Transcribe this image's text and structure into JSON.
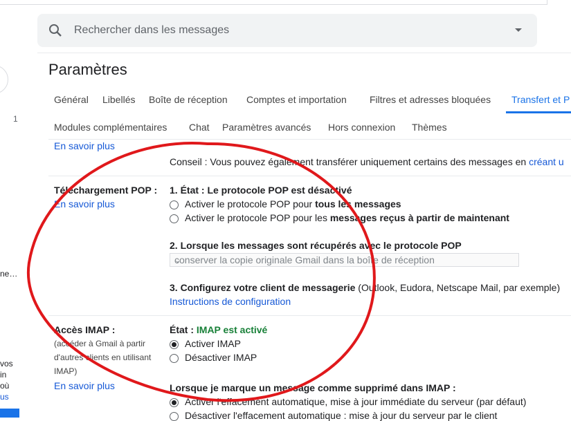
{
  "search": {
    "placeholder": "Rechercher dans les messages"
  },
  "page_title": "Paramètres",
  "left_partial": {
    "count": "1",
    "text1": "ne…",
    "text2": "vos",
    "text3": "in",
    "text4": "où",
    "text5": "us"
  },
  "tabs_row1": [
    "Général",
    "Libellés",
    "Boîte de réception",
    "Comptes et importation",
    "Filtres et adresses bloquées",
    "Transfert et P"
  ],
  "tabs_row2": [
    "Modules complémentaires",
    "Chat",
    "Paramètres avancés",
    "Hors connexion",
    "Thèmes"
  ],
  "forward": {
    "learn_more": "En savoir plus",
    "tip": "Conseil : Vous pouvez également transférer uniquement certains des messages en",
    "tip_link": "créant u"
  },
  "pop": {
    "label": "Téléchargement POP :",
    "learn_more": "En savoir plus",
    "status_heading": "1. État : Le protocole POP est désactivé",
    "opt1_prefix": "Activer le protocole POP pour ",
    "opt1_bold": "tous les messages",
    "opt2_prefix": "Activer le protocole POP pour les ",
    "opt2_bold": "messages reçus à partir de maintenant",
    "step2_heading": "2. Lorsque les messages sont récupérés avec le protocole POP",
    "step2_select": "conserver la copie originale Gmail dans la boîte de réception",
    "step3_bold": "3. Configurez votre client de messagerie",
    "step3_rest": " (Outlook, Eudora, Netscape Mail, par exemple)",
    "step3_link": "Instructions de configuration"
  },
  "imap": {
    "label": "Accès IMAP :",
    "sub1": "(accéder à Gmail à partir",
    "sub2": "d'autres clients en utilisant",
    "sub3": "IMAP)",
    "learn_more": "En savoir plus",
    "status_prefix": "État : ",
    "status_value": "IMAP est activé",
    "opt_enable": "Activer IMAP",
    "opt_disable": "Désactiver IMAP",
    "delete_heading": "Lorsque je marque un message comme supprimé dans IMAP :",
    "delete_opt1": "Activer l'effacement automatique, mise à jour immédiate du serveur (par défaut)",
    "delete_opt2": "Désactiver l'effacement automatique : mise à jour du serveur par le client"
  },
  "colors": {
    "accent": "#1a73e8",
    "link": "#1558d6",
    "success": "#188038",
    "annotation": "#e0181b"
  }
}
